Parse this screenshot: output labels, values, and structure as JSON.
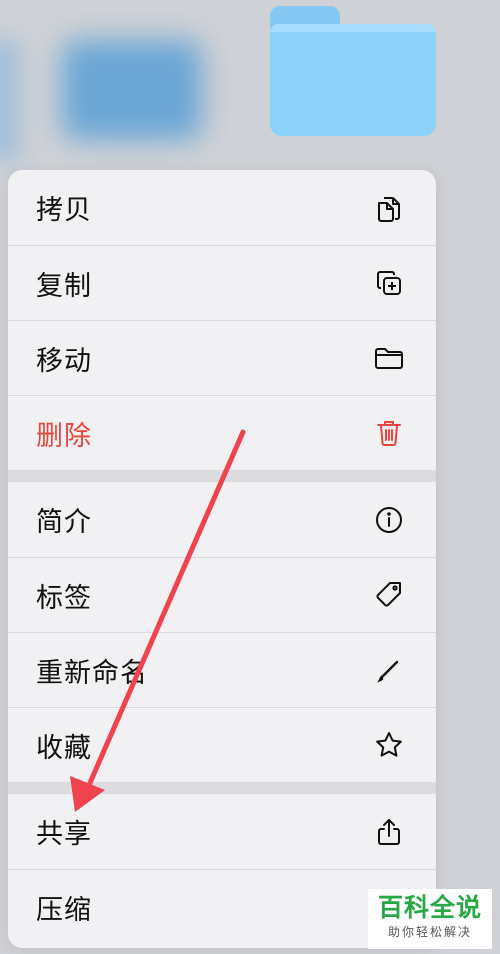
{
  "menu": {
    "items": [
      {
        "label": "拷贝",
        "icon": "copy-icon"
      },
      {
        "label": "复制",
        "icon": "duplicate-icon"
      },
      {
        "label": "移动",
        "icon": "folder-icon"
      },
      {
        "label": "删除",
        "icon": "trash-icon",
        "destructive": true
      },
      {
        "label": "简介",
        "icon": "info-icon"
      },
      {
        "label": "标签",
        "icon": "tag-icon"
      },
      {
        "label": "重新命名",
        "icon": "pencil-icon"
      },
      {
        "label": "收藏",
        "icon": "star-icon"
      },
      {
        "label": "共享",
        "icon": "share-icon"
      },
      {
        "label": "压缩",
        "icon": "archive-icon"
      }
    ]
  },
  "watermark": {
    "title": "百科全说",
    "subtitle": "助你轻松解决"
  },
  "colors": {
    "destructive": "#e8453c",
    "annotation_arrow": "#f0424f",
    "folder": "#8dd2fb",
    "watermark_green": "#28a745"
  }
}
